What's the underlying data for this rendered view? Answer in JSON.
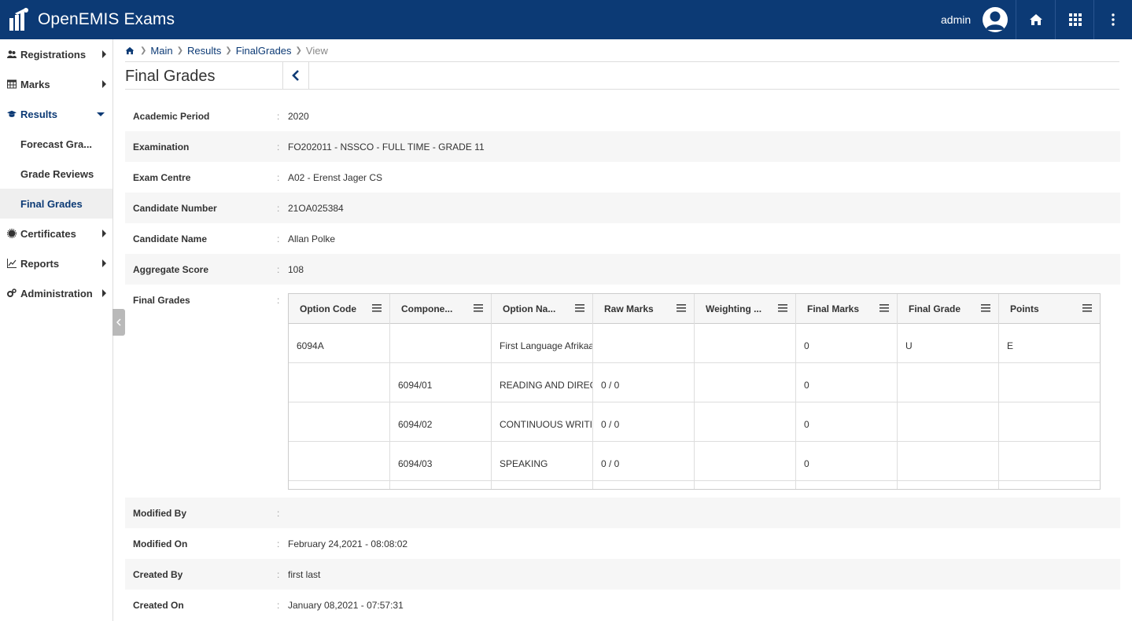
{
  "header": {
    "app_title": "OpenEMIS Exams",
    "user": "admin",
    "icons": [
      "user-avatar-icon",
      "home-icon",
      "apps-grid-icon",
      "more-vertical-icon"
    ]
  },
  "sidebar": {
    "items": [
      {
        "label": "Registrations",
        "icon": "users-icon"
      },
      {
        "label": "Marks",
        "icon": "table-icon"
      },
      {
        "label": "Results",
        "icon": "graduation-cap-icon"
      },
      {
        "label": "Certificates",
        "icon": "certificate-icon"
      },
      {
        "label": "Reports",
        "icon": "line-chart-icon"
      },
      {
        "label": "Administration",
        "icon": "cogs-icon"
      }
    ],
    "results_sub": [
      "Forecast Gra...",
      "Grade Reviews",
      "Final Grades"
    ]
  },
  "breadcrumb": {
    "items": [
      "Main",
      "Results",
      "FinalGrades"
    ],
    "current": "View"
  },
  "page": {
    "title": "Final Grades"
  },
  "details": {
    "academic_period": {
      "label": "Academic Period",
      "value": "2020"
    },
    "examination": {
      "label": "Examination",
      "value": "FO202011 - NSSCO - FULL TIME - GRADE 11"
    },
    "exam_centre": {
      "label": "Exam Centre",
      "value": "A02 - Erenst Jager CS"
    },
    "candidate_number": {
      "label": "Candidate Number",
      "value": "21OA025384"
    },
    "candidate_name": {
      "label": "Candidate Name",
      "value": "Allan Polke"
    },
    "aggregate_score": {
      "label": "Aggregate Score",
      "value": "108"
    },
    "final_grades": {
      "label": "Final Grades"
    },
    "modified_by": {
      "label": "Modified By",
      "value": ""
    },
    "modified_on": {
      "label": "Modified On",
      "value": "February 24,2021 - 08:08:02"
    },
    "created_by": {
      "label": "Created By",
      "value": "first last"
    },
    "created_on": {
      "label": "Created On",
      "value": "January 08,2021 - 07:57:31"
    },
    "colon": ":"
  },
  "grid": {
    "columns": [
      "Option Code",
      "Compone...",
      "Option Na...",
      "Raw Marks",
      "Weighting ...",
      "Final Marks",
      "Final Grade",
      "Points"
    ],
    "rows": [
      [
        "6094A",
        "",
        "First Language Afrikaa",
        "",
        "",
        "0",
        "U",
        "E"
      ],
      [
        "",
        "6094/01",
        "READING AND DIREC",
        "0 / 0",
        "",
        "0",
        "",
        ""
      ],
      [
        "",
        "6094/02",
        "CONTINUOUS WRITII",
        "0 / 0",
        "",
        "0",
        "",
        ""
      ],
      [
        "",
        "6094/03",
        "SPEAKING",
        "0 / 0",
        "",
        "0",
        "",
        ""
      ]
    ]
  }
}
